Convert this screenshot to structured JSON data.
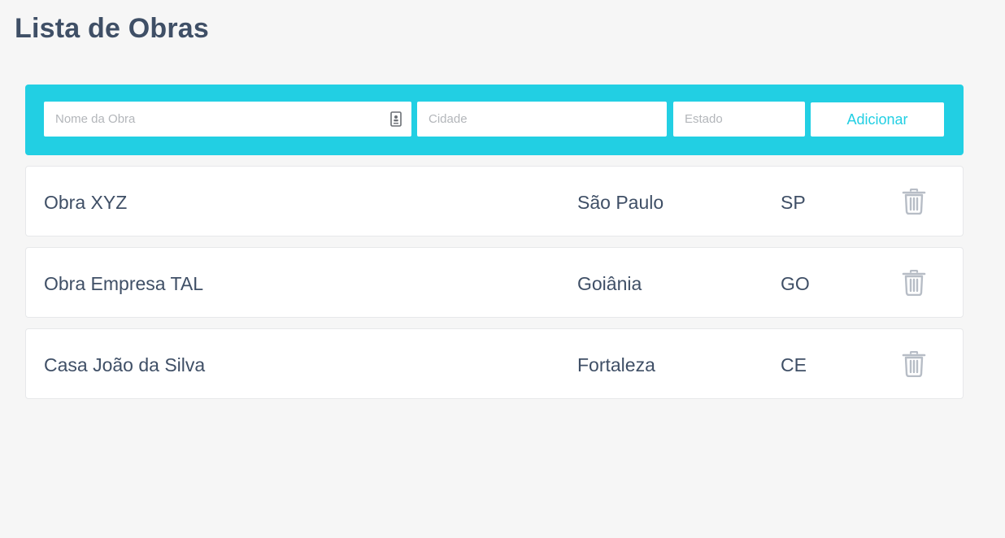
{
  "header": {
    "title": "Lista de Obras"
  },
  "form": {
    "nome_placeholder": "Nome da Obra",
    "nome_value": "",
    "cidade_placeholder": "Cidade",
    "cidade_value": "",
    "estado_placeholder": "Estado",
    "estado_value": "",
    "add_label": "Adicionar",
    "contact_icon": "contact-card-icon"
  },
  "obras": [
    {
      "nome": "Obra XYZ",
      "cidade": "São Paulo",
      "estado": "SP",
      "delete_icon": "trash-icon"
    },
    {
      "nome": "Obra Empresa TAL",
      "cidade": "Goiânia",
      "estado": "GO",
      "delete_icon": "trash-icon"
    },
    {
      "nome": "Casa João da Silva",
      "cidade": "Fortaleza",
      "estado": "CE",
      "delete_icon": "trash-icon"
    }
  ],
  "colors": {
    "accent": "#22cfe3",
    "text": "#3f4f66",
    "background": "#f6f6f6",
    "icon_muted": "#b7bdc6"
  }
}
